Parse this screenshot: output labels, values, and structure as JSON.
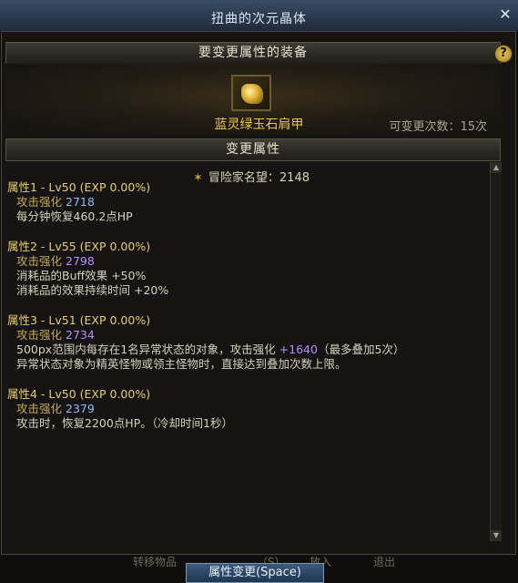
{
  "window": {
    "title": "扭曲的次元晶体"
  },
  "section_equip": {
    "title": "要变更属性的装备"
  },
  "equipment": {
    "name": "蓝灵绿玉石肩甲",
    "change_count_label": "可变更次数：15次"
  },
  "section_attr": {
    "title": "变更属性"
  },
  "fame": {
    "label": "冒险家名望：2148"
  },
  "attributes": [
    {
      "header": "属性1 - Lv50 (EXP 0.00%)",
      "mod_label": "攻击强化",
      "mod_value": "2718",
      "lines": [
        "每分钟恢复460.2点HP"
      ]
    },
    {
      "header": "属性2 - Lv55 (EXP 0.00%)",
      "mod_label": "攻击强化",
      "mod_value": "2798",
      "lines": [
        "消耗品的Buff效果 +50%",
        "消耗品的效果持续时间 +20%"
      ]
    },
    {
      "header": "属性3 - Lv51 (EXP 0.00%)",
      "mod_label": "攻击强化",
      "mod_value": "2734",
      "line1_a": "500px范围内每存在1名异常状态的对象，攻击强化",
      "line1_b": "+1640",
      "line1_c": "（最多叠加5次）",
      "lines": [
        "异常状态对象为精英怪物或领主怪物时，直接达到叠加次数上限。"
      ]
    },
    {
      "header": "属性4 - Lv50 (EXP 0.00%)",
      "mod_label": "攻击强化",
      "mod_value": "2379",
      "lines": [
        "攻击时，恢复2200点HP。（冷却时间1秒）"
      ]
    }
  ],
  "background_labels": [
    "转移物品",
    "（S）",
    "放入",
    "退出"
  ],
  "apply_button": {
    "label": "属性变更(Space)"
  },
  "colors": {
    "title_bar": "#2f4057",
    "gold_text": "#e8c94a",
    "blue_value": "#8fb8ff",
    "purple_value": "#b88cff"
  }
}
